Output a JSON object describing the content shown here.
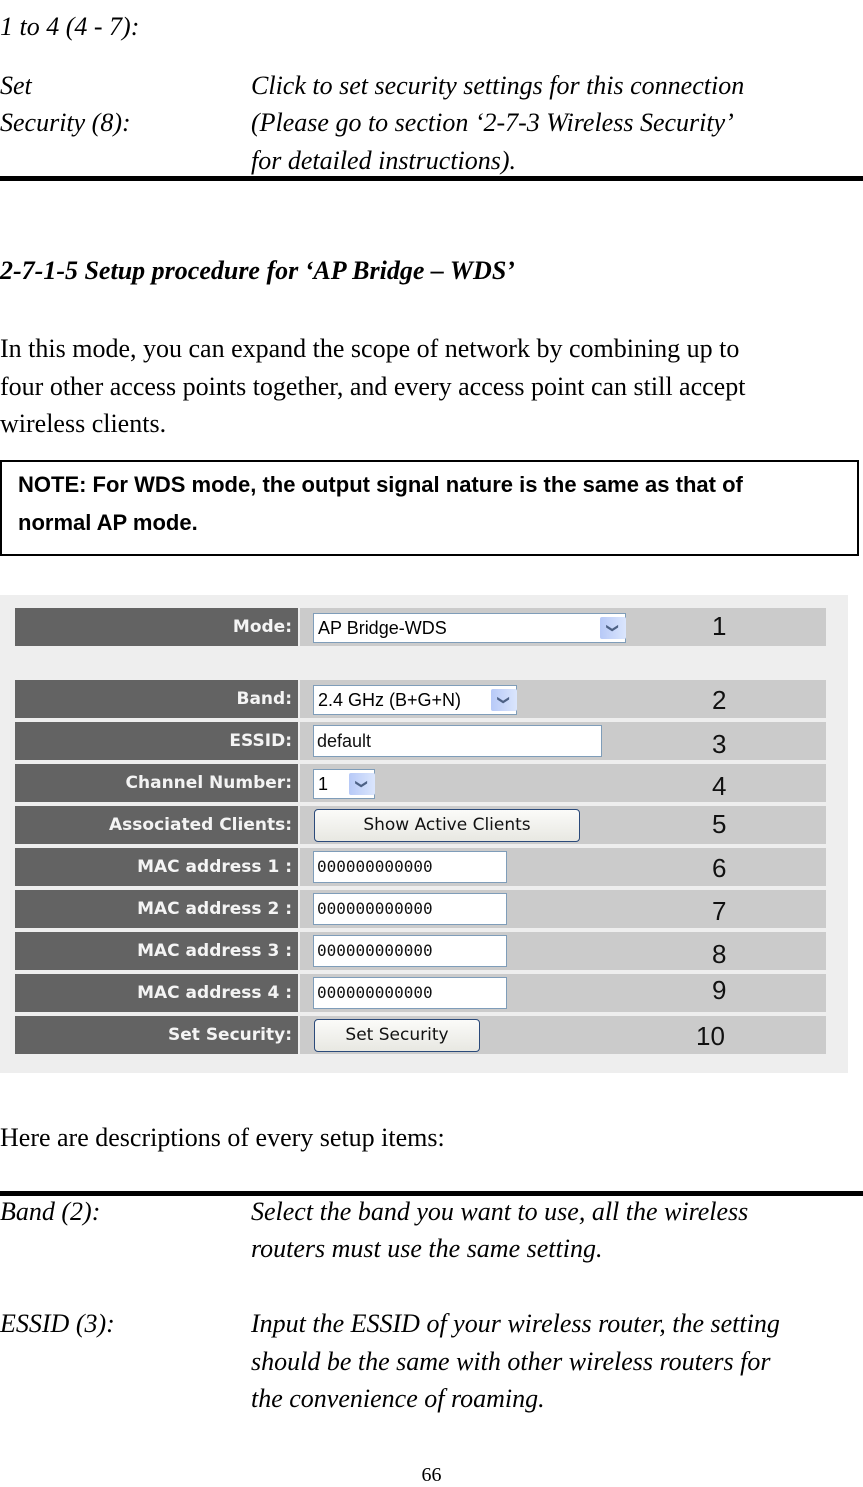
{
  "top_section": {
    "continued_label": "1 to 4 (4 - 7):",
    "set_security_label_line1": "Set",
    "set_security_label_line2": "Security (8):",
    "set_security_desc_line1": "Click to set security settings for this connection",
    "set_security_desc_line2": "(Please go to section ‘2-7-3 Wireless Security’",
    "set_security_desc_line3": "for detailed instructions)."
  },
  "section": {
    "heading": "2-7-1-5 Setup procedure for ‘AP Bridge – WDS’",
    "intro_line1": "In this mode, you can expand the scope of network by combining up to",
    "intro_line2": "four other access points together, and every access point can still accept",
    "intro_line3": "wireless clients.",
    "note_line1": "NOTE: For WDS mode, the output signal nature is the same as that of",
    "note_line2": "normal AP mode."
  },
  "form": {
    "rows": [
      {
        "label": "Mode:",
        "value": "AP Bridge-WDS",
        "control": "select",
        "callout": "1"
      },
      {
        "label": "Band:",
        "value": "2.4 GHz (B+G+N)",
        "control": "select",
        "callout": "2"
      },
      {
        "label": "ESSID:",
        "value": "default",
        "control": "text",
        "callout": "3"
      },
      {
        "label": "Channel Number:",
        "value": "1",
        "control": "select",
        "callout": "4"
      },
      {
        "label": "Associated Clients:",
        "value": "Show Active Clients",
        "control": "button",
        "callout": "5"
      },
      {
        "label": "MAC address 1 :",
        "value": "000000000000",
        "control": "text",
        "callout": "6"
      },
      {
        "label": "MAC address 2 :",
        "value": "000000000000",
        "control": "text",
        "callout": "7"
      },
      {
        "label": "MAC address 3 :",
        "value": "000000000000",
        "control": "text",
        "callout": "8"
      },
      {
        "label": "MAC address 4 :",
        "value": "000000000000",
        "control": "text",
        "callout": "9"
      },
      {
        "label": "Set Security:",
        "value": "Set Security",
        "control": "button",
        "callout": "10"
      }
    ],
    "dropdown_icon": "chevron-down-icon"
  },
  "descriptions": {
    "intro": "Here are descriptions of every setup items:",
    "items": [
      {
        "label": "Band (2):",
        "line1": "Select the band you want to use, all the wireless",
        "line2": "routers must use the same setting."
      },
      {
        "label": "ESSID (3):",
        "line1": "Input the ESSID of your wireless router, the setting",
        "line2": "should be the same with other wireless routers for",
        "line3": "the convenience of roaming."
      }
    ]
  },
  "page_number": "66",
  "colors": {
    "label_bg": "#636363",
    "value_bg": "#cbcbcb",
    "panel_bg": "#eeeeee",
    "input_border": "#7f9db9"
  }
}
